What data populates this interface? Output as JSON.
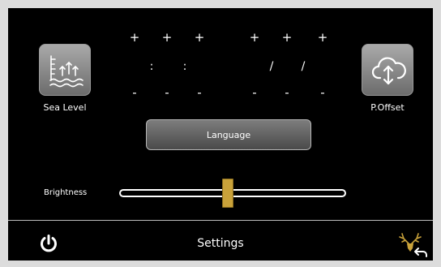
{
  "time": {
    "plus": [
      "+",
      "+",
      "+"
    ],
    "separators": [
      ":",
      ":"
    ],
    "minus": [
      "-",
      "-",
      "-"
    ]
  },
  "date": {
    "plus": [
      "+",
      "+",
      "+"
    ],
    "separators": [
      "/",
      "/"
    ],
    "minus": [
      "-",
      "-",
      "-"
    ]
  },
  "sea_level": {
    "label": "Sea Level",
    "icon": "sea-level-icon"
  },
  "p_offset": {
    "label": "P.Offset",
    "icon": "cloud-arrows-icon"
  },
  "language_button": {
    "label": "Language"
  },
  "brightness": {
    "label": "Brightness",
    "level_percent": 48
  },
  "footer": {
    "title": "Settings",
    "power_icon": "power-icon",
    "brand_icon": "deer-back-icon"
  },
  "colors": {
    "background": "#000000",
    "slider_thumb": "#c9a23a",
    "brand": "#c9a23a"
  }
}
